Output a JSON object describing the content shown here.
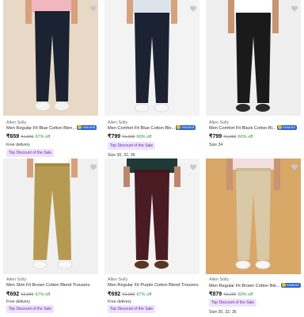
{
  "assured_label": "Assured",
  "products": [
    {
      "brand": "Allen Solly",
      "title": "Men Regular Fit Blue Cotton Blen...",
      "assured": true,
      "price": "₹659",
      "mrp": "₹1,999",
      "discount": "67% off",
      "delivery": "Free delivery",
      "sizes": "",
      "deal": "Top Discount of the Sale"
    },
    {
      "brand": "Allen Solly",
      "title": "Men Comfort Fit Blue Cotton Ble...",
      "assured": true,
      "price": "₹799",
      "mrp": "₹1,999",
      "discount": "60% off",
      "delivery": "",
      "sizes": "",
      "deal": "Top Discount of the Sale"
    },
    {
      "brand": "Allen Solly",
      "title": "Men Comfort Fit Black Cotton Bl...",
      "assured": true,
      "price": "₹799",
      "mrp": "₹1,999",
      "discount": "60% off",
      "delivery": "",
      "sizes": "Size 34",
      "deal": ""
    },
    {
      "brand": "Allen Solly",
      "title": "Men Slim Fit Brown Cotton Blend Trousers",
      "assured": false,
      "price": "₹692",
      "mrp": "₹2,099",
      "discount": "67% off",
      "delivery": "Free delivery",
      "sizes": "",
      "deal": "Top Discount of the Sale"
    },
    {
      "brand": "Allen Solly",
      "title": "Men Regular Fit Purple Cotton Blend Trousers",
      "assured": false,
      "price": "₹692",
      "mrp": "₹2,099",
      "discount": "67% off",
      "delivery": "Free delivery",
      "sizes": "",
      "deal": "Top Discount of the Sale"
    },
    {
      "brand": "Allen Solly",
      "title": "Men Regular Fit Brown Cotton Ble...",
      "assured": true,
      "price": "₹879",
      "mrp": "₹2,199",
      "discount": "60% off",
      "delivery": "",
      "sizes": "",
      "deal": "Top Discount of the Sale"
    }
  ],
  "row1_sizes_2": "Size 30, 32, 36",
  "row2_sizes_3": "Size 30, 32, 36",
  "colors": {
    "pants_navy": "#1b2232",
    "pants_black": "#1a1a1a",
    "pants_khaki": "#b79a52",
    "pants_maroon": "#4a1b22",
    "pants_beige": "#d9c9a6",
    "bg_warm": "#e7d9c5",
    "bg_white": "#f3f3f3",
    "bg_light": "#efefef",
    "bg_tan": "#d9a768",
    "discount_green": "#1f9a3a",
    "deal_purple": "#6b2bb2",
    "assured_blue": "#2a62d4"
  }
}
